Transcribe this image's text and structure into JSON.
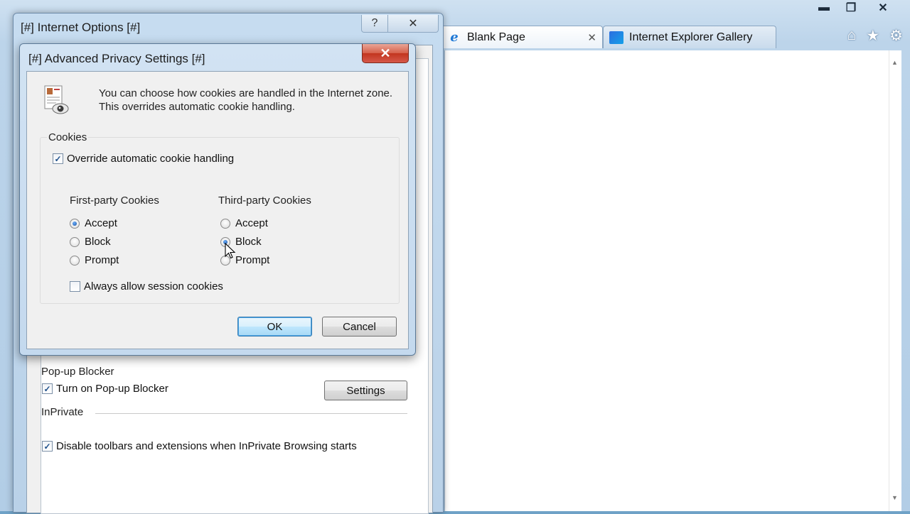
{
  "browser": {
    "tabs": [
      {
        "label": "Blank Page",
        "active": true
      },
      {
        "label": "Internet Explorer Gallery",
        "active": false
      }
    ],
    "window_controls": {
      "minimize": "▬",
      "maximize": "❐",
      "close": "✕"
    },
    "toolbar_icons": [
      "home-icon",
      "favorites-star-icon",
      "tools-gear-icon"
    ],
    "glyphs": {
      "home": "⌂",
      "star": "★",
      "gear": "⚙",
      "tab_close": "✕",
      "ie": "e"
    }
  },
  "internet_options": {
    "title": "[#] Internet Options [#]",
    "help_glyph": "?",
    "close_glyph": "✕",
    "popup_blocker": {
      "section_label": "Pop-up Blocker",
      "checkbox_label": "Turn on Pop-up Blocker",
      "checked": true,
      "settings_button": "Settings"
    },
    "inprivate": {
      "section_label": "InPrivate",
      "checkbox_label": "Disable toolbars and extensions when InPrivate Browsing starts",
      "checked": true
    }
  },
  "advanced_privacy": {
    "title": "[#] Advanced Privacy Settings [#]",
    "close_glyph": "✕",
    "description": "You can choose how cookies are handled in the Internet zone.  This overrides automatic cookie handling.",
    "cookies_group_label": "Cookies",
    "override_label": "Override automatic cookie handling",
    "override_checked": true,
    "first_party": {
      "heading": "First-party Cookies",
      "options": [
        "Accept",
        "Block",
        "Prompt"
      ],
      "selected": "Accept"
    },
    "third_party": {
      "heading": "Third-party Cookies",
      "options": [
        "Accept",
        "Block",
        "Prompt"
      ],
      "selected": "Block"
    },
    "session_label": "Always allow session cookies",
    "session_checked": false,
    "ok_button": "OK",
    "cancel_button": "Cancel",
    "check_glyph": "✓"
  }
}
